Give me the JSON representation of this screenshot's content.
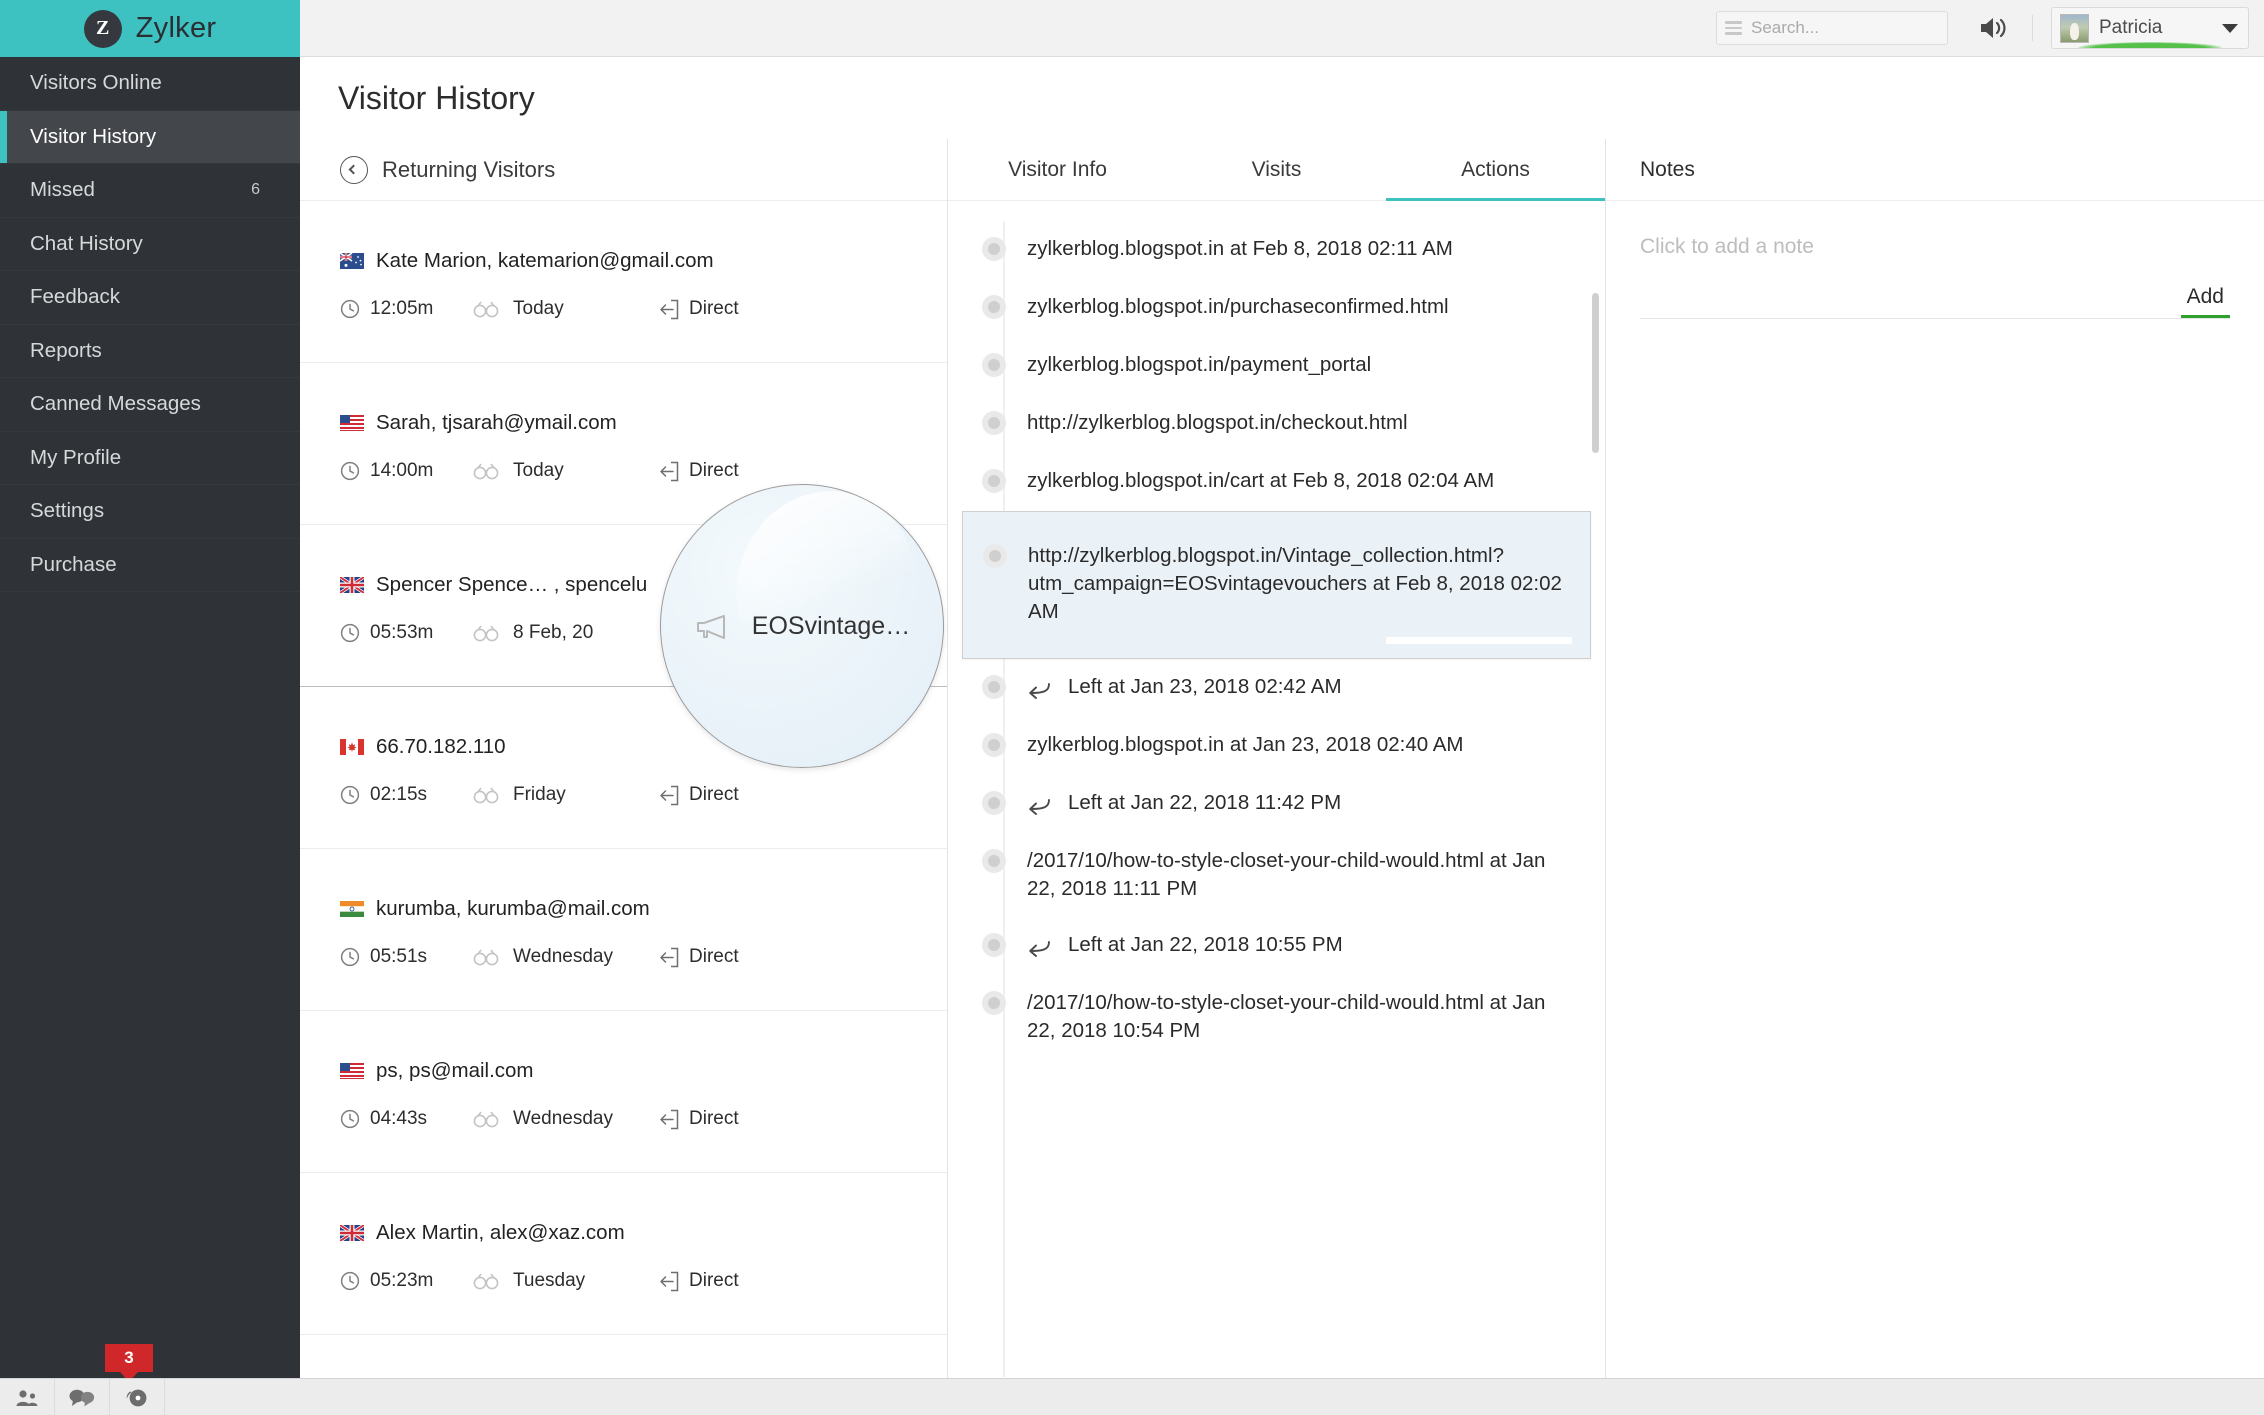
{
  "brand": {
    "logo_letter": "Z",
    "name": "Zylker",
    "accent": "#3ec1c1"
  },
  "topbar": {
    "search_placeholder": "Search...",
    "search_value": "",
    "menu_icon": "hamburger-icon",
    "sound_icon": "speaker-on-icon",
    "user_name": "Patricia",
    "caret_icon": "chevron-down-icon",
    "status_color": "#55c04a"
  },
  "sidebar": {
    "items": [
      {
        "label": "Visitors Online",
        "badge": "",
        "active": false
      },
      {
        "label": "Visitor History",
        "badge": "",
        "active": true
      },
      {
        "label": "Missed",
        "badge": "6",
        "active": false
      },
      {
        "label": "Chat History",
        "badge": "",
        "active": false
      },
      {
        "label": "Feedback",
        "badge": "",
        "active": false
      },
      {
        "label": "Reports",
        "badge": "",
        "active": false
      },
      {
        "label": "Canned Messages",
        "badge": "",
        "active": false
      },
      {
        "label": "My Profile",
        "badge": "",
        "active": false
      },
      {
        "label": "Settings",
        "badge": "",
        "active": false
      },
      {
        "label": "Purchase",
        "badge": "",
        "active": false
      }
    ],
    "tray_badge": "3"
  },
  "taskbar": {
    "buttons": [
      {
        "icon": "visitors-people-icon"
      },
      {
        "icon": "chat-bubbles-icon"
      },
      {
        "icon": "alarm-bell-icon"
      }
    ]
  },
  "page": {
    "title": "Visitor History"
  },
  "visitors_panel": {
    "back_icon": "chevron-left-circle-icon",
    "heading": "Returning Visitors",
    "column_icons": {
      "duration": "clock-icon",
      "visits": "binoculars-icon",
      "referrer": "enter-arrow-icon"
    },
    "rows": [
      {
        "flag": "AU",
        "name": "Kate Marion, katemarion@gmail.com",
        "duration": "12:05m",
        "when": "Today",
        "referrer": "Direct"
      },
      {
        "flag": "US",
        "name": "Sarah, tjsarah@ymail.com",
        "duration": "14:00m",
        "when": "Today",
        "referrer": "Direct"
      },
      {
        "flag": "GB",
        "name": "Spencer Spence… , spencelu",
        "duration": "05:53m",
        "when": "8 Feb, 20",
        "referrer": ""
      },
      {
        "flag": "CA",
        "name": "66.70.182.110",
        "duration": "02:15s",
        "when": "Friday",
        "referrer": "Direct"
      },
      {
        "flag": "IN",
        "name": "kurumba, kurumba@mail.com",
        "duration": "05:51s",
        "when": "Wednesday",
        "referrer": "Direct"
      },
      {
        "flag": "US",
        "name": "ps, ps@mail.com",
        "duration": "04:43s",
        "when": "Wednesday",
        "referrer": "Direct"
      },
      {
        "flag": "GB",
        "name": "Alex Martin, alex@xaz.com",
        "duration": "05:23m",
        "when": "Tuesday",
        "referrer": "Direct"
      }
    ]
  },
  "detail_panel": {
    "tabs": [
      {
        "label": "Visitor Info",
        "active": false
      },
      {
        "label": "Visits",
        "active": false
      },
      {
        "label": "Actions",
        "active": true
      }
    ],
    "actions": [
      {
        "text": "zylkerblog.blogspot.in at Feb 8, 2018  02:11 AM",
        "left": false,
        "highlight": false
      },
      {
        "text": "zylkerblog.blogspot.in/purchaseconfirmed.html",
        "left": false,
        "highlight": false
      },
      {
        "text": "zylkerblog.blogspot.in/payment_portal",
        "left": false,
        "highlight": false
      },
      {
        "text": "http://zylkerblog.blogspot.in/checkout.html",
        "left": false,
        "highlight": false
      },
      {
        "text": "zylkerblog.blogspot.in/cart at Feb 8, 2018  02:04 AM",
        "left": false,
        "highlight": false
      },
      {
        "text": "http://zylkerblog.blogspot.in/Vintage_collection.html?utm_campaign=EOSvintagevouchers at Feb 8, 2018  02:02 AM",
        "left": false,
        "highlight": true
      },
      {
        "text": "Left at Jan 23, 2018  02:42 AM",
        "left": true,
        "highlight": false
      },
      {
        "text": "zylkerblog.blogspot.in at Jan 23, 2018  02:40 AM",
        "left": false,
        "highlight": false
      },
      {
        "text": "Left at Jan 22, 2018  11:42 PM",
        "left": true,
        "highlight": false
      },
      {
        "text": "/2017/10/how-to-style-closet-your-child-would.html at Jan 22, 2018  11:11 PM",
        "left": false,
        "highlight": false
      },
      {
        "text": "Left at Jan 22, 2018  10:55 PM",
        "left": true,
        "highlight": false
      },
      {
        "text": "/2017/10/how-to-style-closet-your-child-would.html at Jan 22, 2018  10:54 PM",
        "left": false,
        "highlight": false
      }
    ]
  },
  "notes_panel": {
    "heading": "Notes",
    "placeholder": "Click to add a note",
    "note_value": "",
    "add_label": "Add",
    "add_underline_color": "#2fa02f"
  },
  "magnifier": {
    "icon": "megaphone-campaign-icon",
    "text": "EOSvintage…"
  }
}
